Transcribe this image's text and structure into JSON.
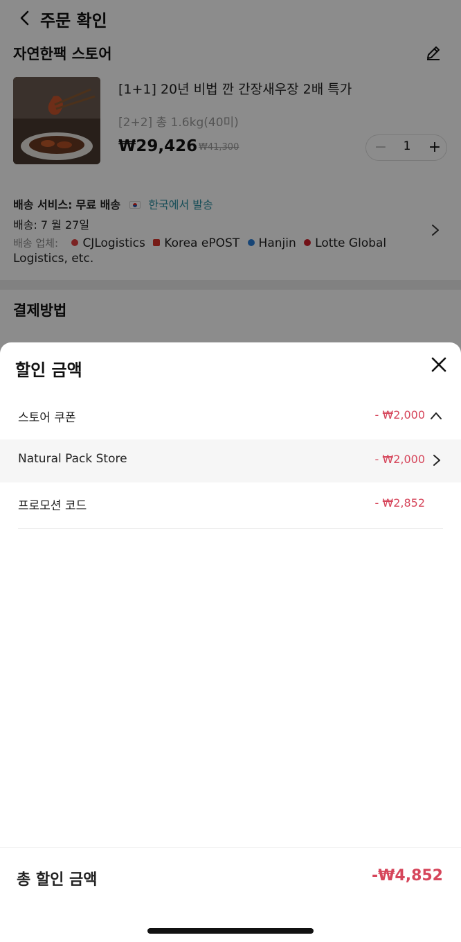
{
  "header": {
    "title": "주문 확인"
  },
  "store": {
    "name": "자연한팩 스토어"
  },
  "product": {
    "title": "[1+1] 20년 비법 깐 간장새우장 2배 특가",
    "option": "[2+2] 총 1.6kg(40미)",
    "price": "₩29,426",
    "original_price": "₩41,300",
    "quantity": "1",
    "minus": "−",
    "plus": "+"
  },
  "shipping": {
    "service_label": "배송 서비스:",
    "service_value": "무료 배송",
    "origin": "한국에서 발송",
    "date": "배송: 7 월 27일",
    "carriers_label": "배송 업체:",
    "carriers": [
      "CJLogistics",
      "Korea ePOST",
      "Hanjin",
      "Lotte Global Logistics, etc."
    ]
  },
  "payment": {
    "title": "결제방법"
  },
  "sheet": {
    "title": "할인 금액",
    "rows": [
      {
        "label": "스토어 쿠폰",
        "amount": "- ₩2,000"
      },
      {
        "label": "Natural Pack Store",
        "amount": "- ₩2,000"
      },
      {
        "label": "프로모션 코드",
        "amount": "- ₩2,852"
      }
    ],
    "total_label": "총 할인 금액",
    "total_amount": "-₩4,852"
  },
  "colors": {
    "discount": "#d6465b",
    "link": "#2a8fa0"
  }
}
